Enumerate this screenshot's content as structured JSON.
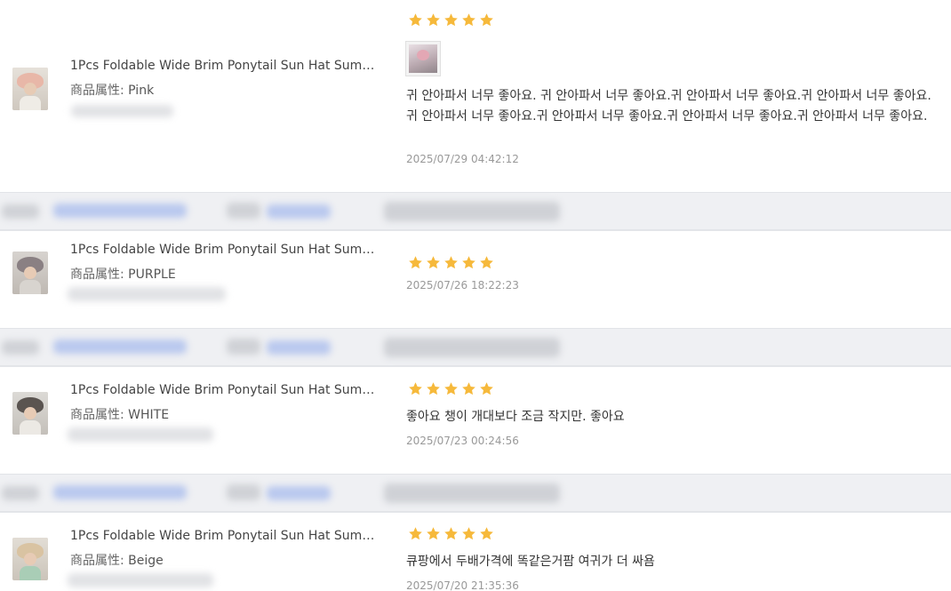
{
  "colors": {
    "star": "#f6b93b",
    "order_bar": "#eff0f3",
    "timestamp": "#999999"
  },
  "attr_key": "商品属性:",
  "reviews": [
    {
      "product": "1Pcs Foldable Wide Brim Ponytail Sun Hat Summer...",
      "attr_value": "Pink",
      "rating": 5,
      "photo": "review-photo-thumbnail",
      "comment": "귀 안아파서 너무 좋아요. 귀 안아파서 너무 좋아요.귀 안아파서 너무 좋아요.귀 안아파서 너무 좋아요.귀 안아파서 너무 좋아요.귀 안아파서 너무 좋아요.귀 안아파서 너무 좋아요.귀 안아파서 너무 좋아요.",
      "time": "2025/07/29 04:42:12"
    },
    {
      "product": "1Pcs Foldable Wide Brim Ponytail Sun Hat Summer...",
      "attr_value": "PURPLE",
      "rating": 5,
      "comment": "",
      "time": "2025/07/26 18:22:23"
    },
    {
      "product": "1Pcs Foldable Wide Brim Ponytail Sun Hat Summer...",
      "attr_value": "WHITE",
      "rating": 5,
      "comment": "좋아요 챙이 개대보다 조금 작지만. 좋아요",
      "time": "2025/07/23 00:24:56"
    },
    {
      "product": "1Pcs Foldable Wide Brim Ponytail Sun Hat Summer...",
      "attr_value": "Beige",
      "rating": 5,
      "comment": "큐팡에서 두배가격에 똑같은거팜 여귀가 더 싸욤",
      "time": "2025/07/20 21:35:36"
    }
  ]
}
